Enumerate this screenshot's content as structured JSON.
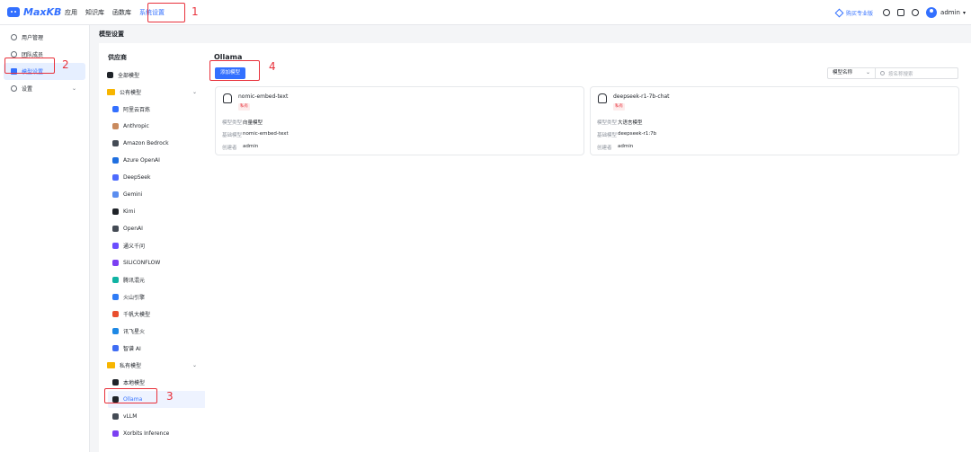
{
  "app": {
    "logo_text": "MaxKB"
  },
  "topnav": {
    "items": [
      "应用",
      "知识库",
      "函数库",
      "系统设置"
    ],
    "active_index": 3
  },
  "topright": {
    "buy_label": "购买专业版",
    "user": "admin"
  },
  "sidebar": {
    "items": [
      {
        "label": "用户管理",
        "icon": "user-icon"
      },
      {
        "label": "团队成员",
        "icon": "team-icon"
      },
      {
        "label": "模型设置",
        "icon": "model-icon",
        "active": true
      },
      {
        "label": "设置",
        "icon": "gear-icon",
        "expandable": true
      }
    ]
  },
  "page": {
    "title": "模型设置"
  },
  "providers": {
    "title": "供应商",
    "all_label": "全部模型",
    "public_label": "公有模型",
    "public_items": [
      {
        "label": "阿里云百炼",
        "color": "#3370ff"
      },
      {
        "label": "Anthropic",
        "color": "#c98a5d"
      },
      {
        "label": "Amazon Bedrock",
        "color": "#444b55"
      },
      {
        "label": "Azure OpenAI",
        "color": "#1f6fe0"
      },
      {
        "label": "DeepSeek",
        "color": "#4d6bfe"
      },
      {
        "label": "Gemini",
        "color": "#5b8def"
      },
      {
        "label": "Kimi",
        "color": "#1f2329"
      },
      {
        "label": "OpenAI",
        "color": "#444b55"
      },
      {
        "label": "通义千问",
        "color": "#6a4dff"
      },
      {
        "label": "SILICONFLOW",
        "color": "#7b3ff2"
      },
      {
        "label": "腾讯混元",
        "color": "#10b3a3"
      },
      {
        "label": "火山引擎",
        "color": "#2f7cf6"
      },
      {
        "label": "千帆大模型",
        "color": "#e94f2e"
      },
      {
        "label": "讯飞星火",
        "color": "#1e88e5"
      },
      {
        "label": "智谱 AI",
        "color": "#3f6df4"
      }
    ],
    "private_label": "私有模型",
    "private_items": [
      {
        "label": "本地模型",
        "color": "#1f2329"
      },
      {
        "label": "Ollama",
        "color": "#1f2329",
        "active": true
      },
      {
        "label": "vLLM",
        "color": "#444b55"
      },
      {
        "label": "Xorbits Inference",
        "color": "#7b3ff2"
      }
    ]
  },
  "content": {
    "title": "Ollama",
    "add_button": "添加模型",
    "filter_select": "模型名称",
    "search_placeholder": "按名称搜索",
    "cards": [
      {
        "name": "nomic-embed-text",
        "badge": "私有",
        "type_key": "模型类型",
        "type": "向量模型",
        "base_key": "基础模型",
        "base": "nomic-embed-text",
        "creator_key": "创建者",
        "creator": "admin"
      },
      {
        "name": "deepseek-r1-7b-chat",
        "badge": "私有",
        "type_key": "模型类型",
        "type": "大语言模型",
        "base_key": "基础模型",
        "base": "deepseek-r1:7b",
        "creator_key": "创建者",
        "creator": "admin"
      }
    ]
  },
  "annotations": [
    "1",
    "2",
    "3",
    "4"
  ]
}
